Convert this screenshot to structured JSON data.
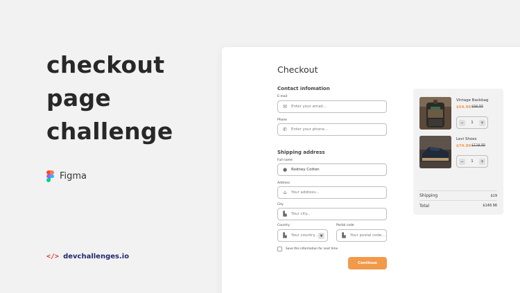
{
  "promo": {
    "title_lines": [
      "checkout",
      "page",
      "challenge"
    ],
    "tool": "Figma",
    "site_icon": "</>",
    "site": "devchallenges.io"
  },
  "checkout": {
    "title": "Checkout",
    "contact_section": "Contact infomation",
    "email_label": "E-mail",
    "email_placeholder": "Enter your email...",
    "phone_label": "Phone",
    "phone_placeholder": "Enter your phone...",
    "shipping_section": "Shipping address",
    "fullname_label": "Full name",
    "fullname_value": "Rodney Cotton",
    "address_label": "Address",
    "address_placeholder": "Your address...",
    "city_label": "City",
    "city_placeholder": "Your city...",
    "country_label": "Country",
    "country_placeholder": "Your country...",
    "postal_label": "Postal code",
    "postal_placeholder": "Your postal code...",
    "save_label": "Save this information for next time",
    "continue_label": "Continue"
  },
  "cart": {
    "items": [
      {
        "name": "Vintage Backbag",
        "price": "$54.99",
        "old_price": "$94.99",
        "qty": "1"
      },
      {
        "name": "Levi Shoes",
        "price": "$74.99",
        "old_price": "$124.99",
        "qty": "1"
      }
    ],
    "minus": "−",
    "plus": "+",
    "shipping_label": "Shipping",
    "shipping_value": "$19",
    "total_label": "Total",
    "total_value": "$148.98"
  },
  "colors": {
    "accent": "#f2994a",
    "brand_red": "#e0383e",
    "brand_navy": "#22276e",
    "background": "#f2f2f2"
  },
  "icons": {
    "email": "mail-icon",
    "phone": "phone-icon",
    "fullname": "account-icon",
    "address": "home-icon",
    "city": "city-icon",
    "country": "flag-icon",
    "postal": "postal-icon",
    "dropdown": "chevron-down-icon"
  }
}
